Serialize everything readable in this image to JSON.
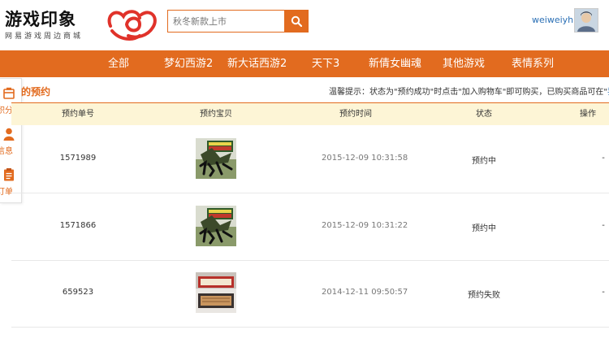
{
  "header": {
    "logo_title": "游戏印象",
    "logo_sub": "网易游戏周边商城",
    "search_placeholder": "秋冬新款上市",
    "username": "weiweiyh"
  },
  "nav": {
    "items": [
      "全部",
      "梦幻西游2",
      "新大话西游2",
      "天下3",
      "新倩女幽魂",
      "其他游戏",
      "表情系列"
    ]
  },
  "side": {
    "items": [
      {
        "label": "积分",
        "icon": "points-icon"
      },
      {
        "label": "信息",
        "icon": "user-icon"
      },
      {
        "label": "订单",
        "icon": "order-icon"
      }
    ]
  },
  "main": {
    "title": "的预约",
    "tip_prefix": "温馨提示：状态为\"预约成功\"时点击\"加入购物车\"即可购买，已购买商品可在\"",
    "tip_link": "我"
  },
  "table": {
    "headers": [
      "预约单号",
      "预约宝贝",
      "预约时间",
      "状态",
      "操作"
    ],
    "rows": [
      {
        "id": "1571989",
        "time": "2015-12-09 10:31:58",
        "status": "预约中",
        "action": "-",
        "thumb": "duxiaozhanshen"
      },
      {
        "id": "1571866",
        "time": "2015-12-09 10:31:22",
        "status": "预约中",
        "action": "-",
        "thumb": "duxiaozhanshen"
      },
      {
        "id": "659523",
        "time": "2014-12-11 09:50:57",
        "status": "预约失败",
        "action": "-",
        "thumb": "nanhai"
      }
    ]
  },
  "colors": {
    "accent": "#e26b1f",
    "header_bg": "#fdf5d6",
    "link": "#2a6fb5"
  }
}
